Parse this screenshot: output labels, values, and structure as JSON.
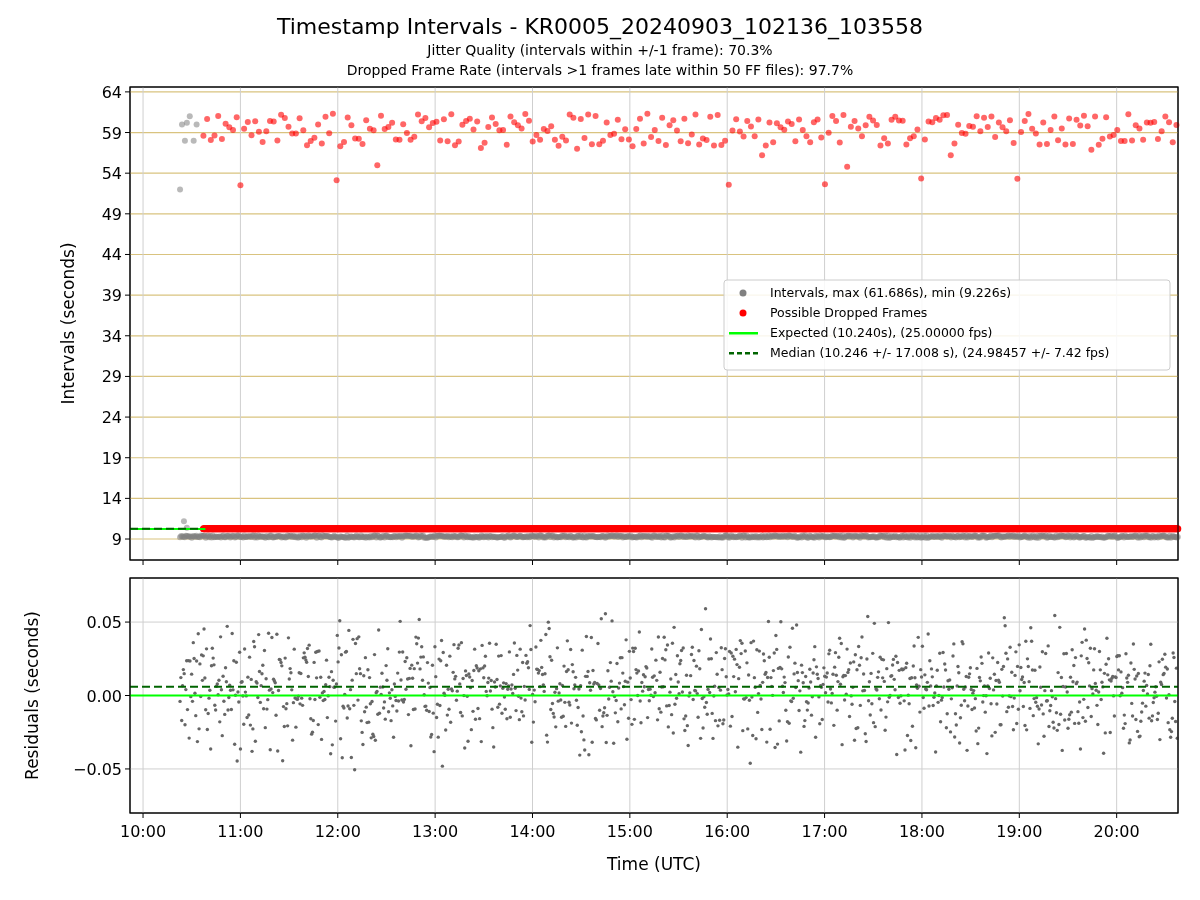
{
  "figure": {
    "title": "Timestamp Intervals - KR0005_20240903_102136_103558",
    "subtitles": [
      "Jitter Quality (intervals within +/-1 frame): 70.3%",
      "Dropped Frame Rate (intervals >1 frames late within 50 FF files): 97.7%"
    ]
  },
  "intervals_panel": {
    "y_axis_label": "Intervals (seconds)",
    "y_tick_labels": [
      "64",
      "59",
      "54",
      "49",
      "44",
      "39",
      "34",
      "29",
      "24",
      "19",
      "14",
      "9"
    ],
    "legend": [
      {
        "label": "Intervals, max (61.686s), min (9.226s)",
        "color": "#808080",
        "kind": "marker"
      },
      {
        "label": "Possible Dropped Frames",
        "color": "#ff0000",
        "kind": "marker"
      },
      {
        "label": "Expected (10.240s), (25.00000 fps)",
        "color": "#00ff00",
        "kind": "line"
      },
      {
        "label": "Median (10.246 +/- 17.008 s), (24.98457 +/- 7.42 fps)",
        "color": "#006400",
        "kind": "dashed"
      }
    ]
  },
  "residuals_panel": {
    "y_axis_label": "Residuals (seconds)",
    "y_tick_labels": [
      "0.05",
      "0.00",
      "−0.05"
    ],
    "x_tick_labels": [
      "10:00",
      "11:00",
      "12:00",
      "13:00",
      "14:00",
      "15:00",
      "16:00",
      "17:00",
      "18:00",
      "19:00",
      "20:00"
    ],
    "x_axis_label": "Time (UTC)"
  }
}
